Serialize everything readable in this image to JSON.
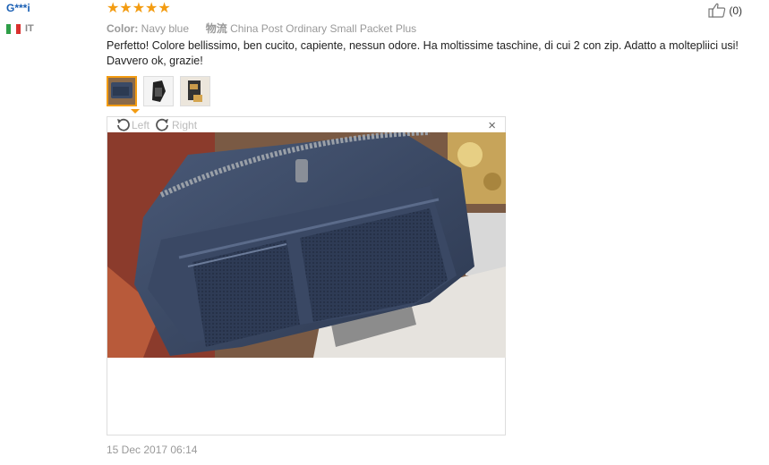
{
  "user": {
    "name": "G***i",
    "country_code": "IT"
  },
  "rating": {
    "stars": "★★★★★",
    "value": 5
  },
  "helpful": {
    "count": "(0)"
  },
  "meta": {
    "color_key": "Color:",
    "color_value": "Navy blue",
    "shipping_key": "物流",
    "shipping_value": "China Post Ordinary Small Packet Plus"
  },
  "review": {
    "text": "Perfetto! Colore bellissimo, ben cucito, capiente, nessun odore. Ha moltissime taschine, di cui 2 con zip. Adatto a moltepliici usi! Davvero ok, grazie!",
    "date": "15 Dec 2017 06:14"
  },
  "viewer": {
    "left_label": "Left",
    "right_label": "Right",
    "close_label": "×"
  },
  "colors": {
    "star": "#f39c12",
    "username": "#1a5fb4",
    "bag": "#3a4a66"
  }
}
